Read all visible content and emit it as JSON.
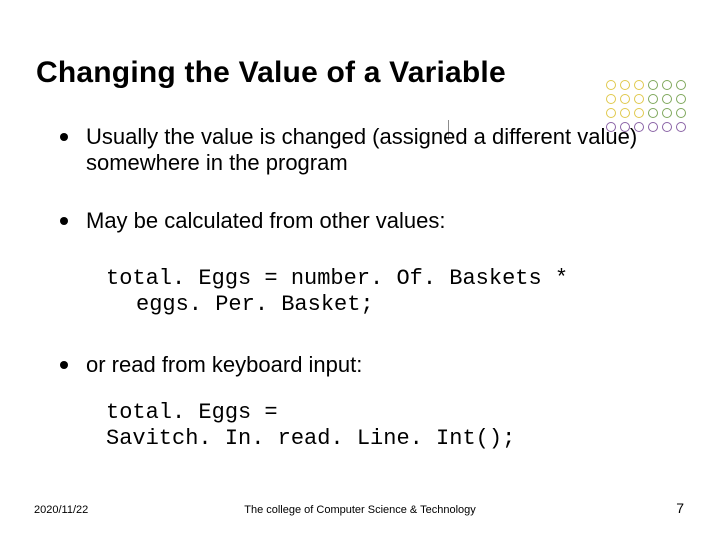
{
  "title": "Changing the Value of a Variable",
  "bullets": {
    "b1": "Usually the value is changed (assigned a different value) somewhere in the program",
    "b2": "May be calculated from other values:",
    "b3": "or read from keyboard input:"
  },
  "code": {
    "c1_line1": "total. Eggs = number. Of. Baskets *",
    "c1_line2": "eggs. Per. Basket;",
    "c2_line1": "total. Eggs =",
    "c2_line2": "Savitch. In. read. Line. Int();"
  },
  "footer": {
    "date": "2020/11/22",
    "center": "The college of Computer Science & Technology",
    "page": "7"
  }
}
